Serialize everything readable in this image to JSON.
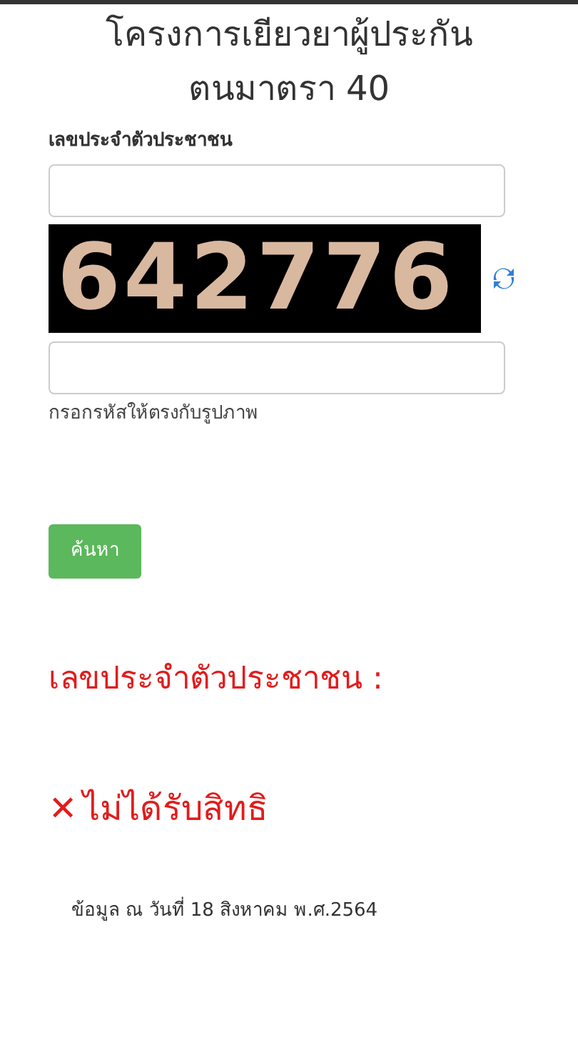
{
  "title_lines": [
    "โครงการเยียวยาผู้ประกัน",
    "ตนมาตรา 40"
  ],
  "id_field": {
    "label": "เลขประจำตัวประชาชน"
  },
  "captcha": {
    "code": "642776"
  },
  "captcha_field": {
    "hint": "กรอกรหัสให้ตรงกับรูปภาพ"
  },
  "search_button": "ค้นหา",
  "result_label": "เลขประจำตัวประชาชน :",
  "result": {
    "icon": "✕",
    "text": "ไม่ได้รับสิทธิ"
  },
  "footer": "ข้อมูล ณ วันที่ 18 สิงหาคม พ.ศ.2564"
}
